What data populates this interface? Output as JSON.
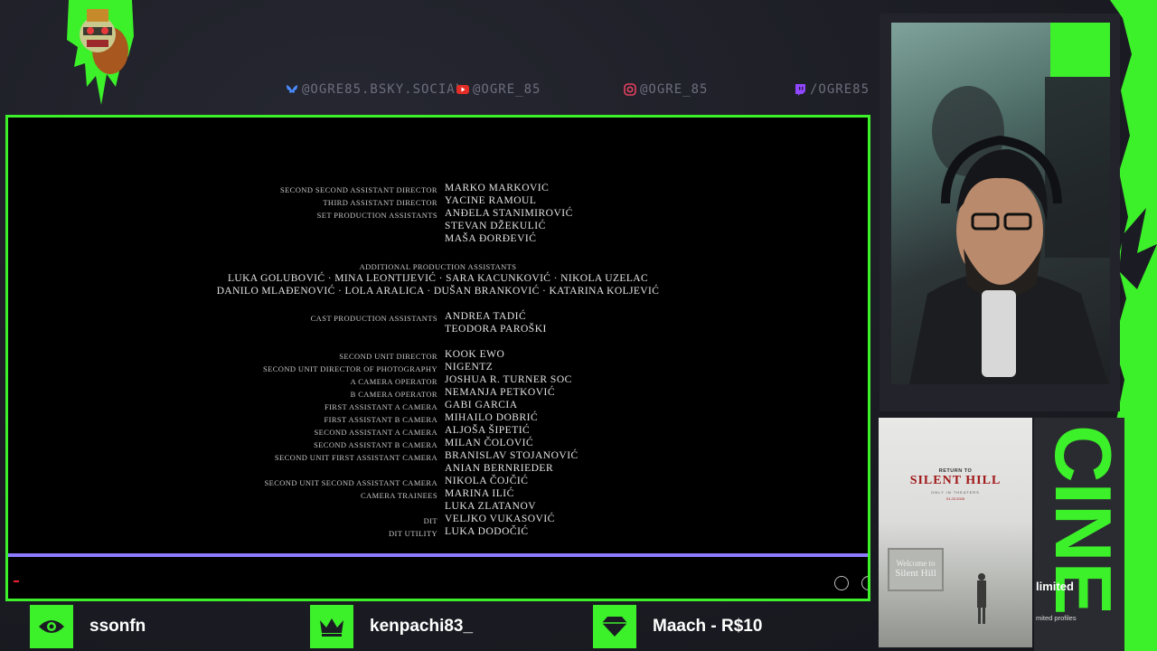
{
  "social": [
    {
      "icon": "bluesky-icon",
      "text": "@OGRE85.BSKY.SOCIAL",
      "color": "#4a8cff"
    },
    {
      "icon": "youtube-icon",
      "text": "@OGRE_85",
      "color": "#e52d27"
    },
    {
      "icon": "instagram-icon",
      "text": "@OGRE_85",
      "color": "#e4405f"
    },
    {
      "icon": "twitch-icon",
      "text": "/OGRE85",
      "color": "#9146ff"
    }
  ],
  "credits": {
    "group1": [
      {
        "role": "Second second assistant director",
        "names": [
          "MARKO MARKOVIĆ"
        ]
      },
      {
        "role": "Third assistant director",
        "names": [
          "YACINE RAMOUL"
        ]
      },
      {
        "role": "Set production assistants",
        "names": [
          "ANĐELA STANIMIROVIĆ",
          "STEVAN DŽEKULIĆ",
          "MAŠA ĐORĐEVIĆ"
        ]
      }
    ],
    "additional_heading": "Additional production assistants",
    "additional_line1": "LUKA GOLUBOVIĆ · MINA LEONTIJEVIĆ · SARA KACUNKOVIĆ · NIKOLA UZELAC",
    "additional_line2": "DANILO MLAĐENOVIĆ · LOLA ARALICA · DUŠAN BRANKOVIĆ · KATARINA KOLJEVIĆ",
    "group2": [
      {
        "role": "Cast production assistants",
        "names": [
          "ANDREA TADIĆ",
          "TEODORA PAROŠKI"
        ]
      }
    ],
    "group3": [
      {
        "role": "Second unit director",
        "names": [
          "KOOK EWO"
        ]
      },
      {
        "role": "Second unit director of photography",
        "names": [
          "NIGENTZ"
        ]
      },
      {
        "role": "A camera operator",
        "names": [
          "JOSHUA R. TURNER SOC"
        ]
      },
      {
        "role": "B camera operator",
        "names": [
          "NEMANJA PETKOVIĆ"
        ]
      },
      {
        "role": "First assistant A camera",
        "names": [
          "GABI GARCIA"
        ]
      },
      {
        "role": "First assistant B camera",
        "names": [
          "MIHAILO DOBRIĆ"
        ]
      },
      {
        "role": "Second assistant A camera",
        "names": [
          "ALJOŠA ŠIPETIĆ"
        ]
      },
      {
        "role": "Second assistant B camera",
        "names": [
          "MILAN ČOLOVIĆ"
        ]
      },
      {
        "role": "Second unit first assistant camera",
        "names": [
          "BRANISLAV STOJANOVIĆ",
          "ANIAN BERNRIEDER"
        ]
      },
      {
        "role": "Second unit second assistant camera",
        "names": [
          "NIKOLA ČOJČIĆ"
        ]
      },
      {
        "role": "Camera trainees",
        "names": [
          "MARINA ILIĆ",
          "LUKA ZLATANOV"
        ]
      },
      {
        "role": "DIT",
        "names": [
          "VELJKO VUKASOVIĆ"
        ]
      },
      {
        "role": "DIT utility",
        "names": [
          "LUKA DODOČIĆ"
        ]
      }
    ]
  },
  "player": {
    "progress_fraction": 1.0
  },
  "poster": {
    "line1": "RETURN TO",
    "title": "SILENT HILL",
    "tagline": "ONLY IN THEATERS",
    "date": "01.23.2026",
    "sign_line1": "Welcome to",
    "sign_line2": "Silent Hill"
  },
  "promo": {
    "big_text": "CINE",
    "limited": "limited",
    "limited_sub": "mited profiles"
  },
  "events": [
    {
      "icon": "eye-icon",
      "label": "ssonfn"
    },
    {
      "icon": "crown-icon",
      "label": "kenpachi83_"
    },
    {
      "icon": "diamond-icon",
      "label": "Maach - R$10"
    }
  ],
  "colors": {
    "accent": "#3cf02a",
    "progress": "#5a48c8",
    "background": "#1b1c23"
  }
}
